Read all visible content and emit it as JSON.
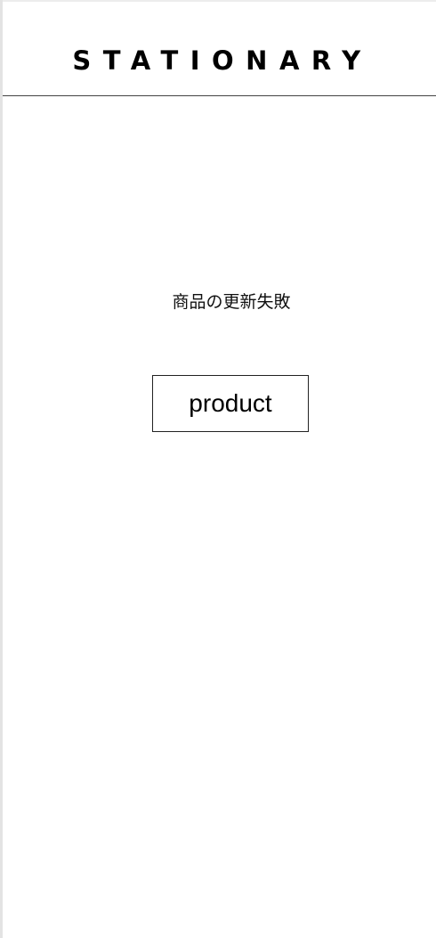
{
  "header": {
    "logo_text": "STATIONARY"
  },
  "main": {
    "message": "商品の更新失敗",
    "product_link_label": "product"
  }
}
